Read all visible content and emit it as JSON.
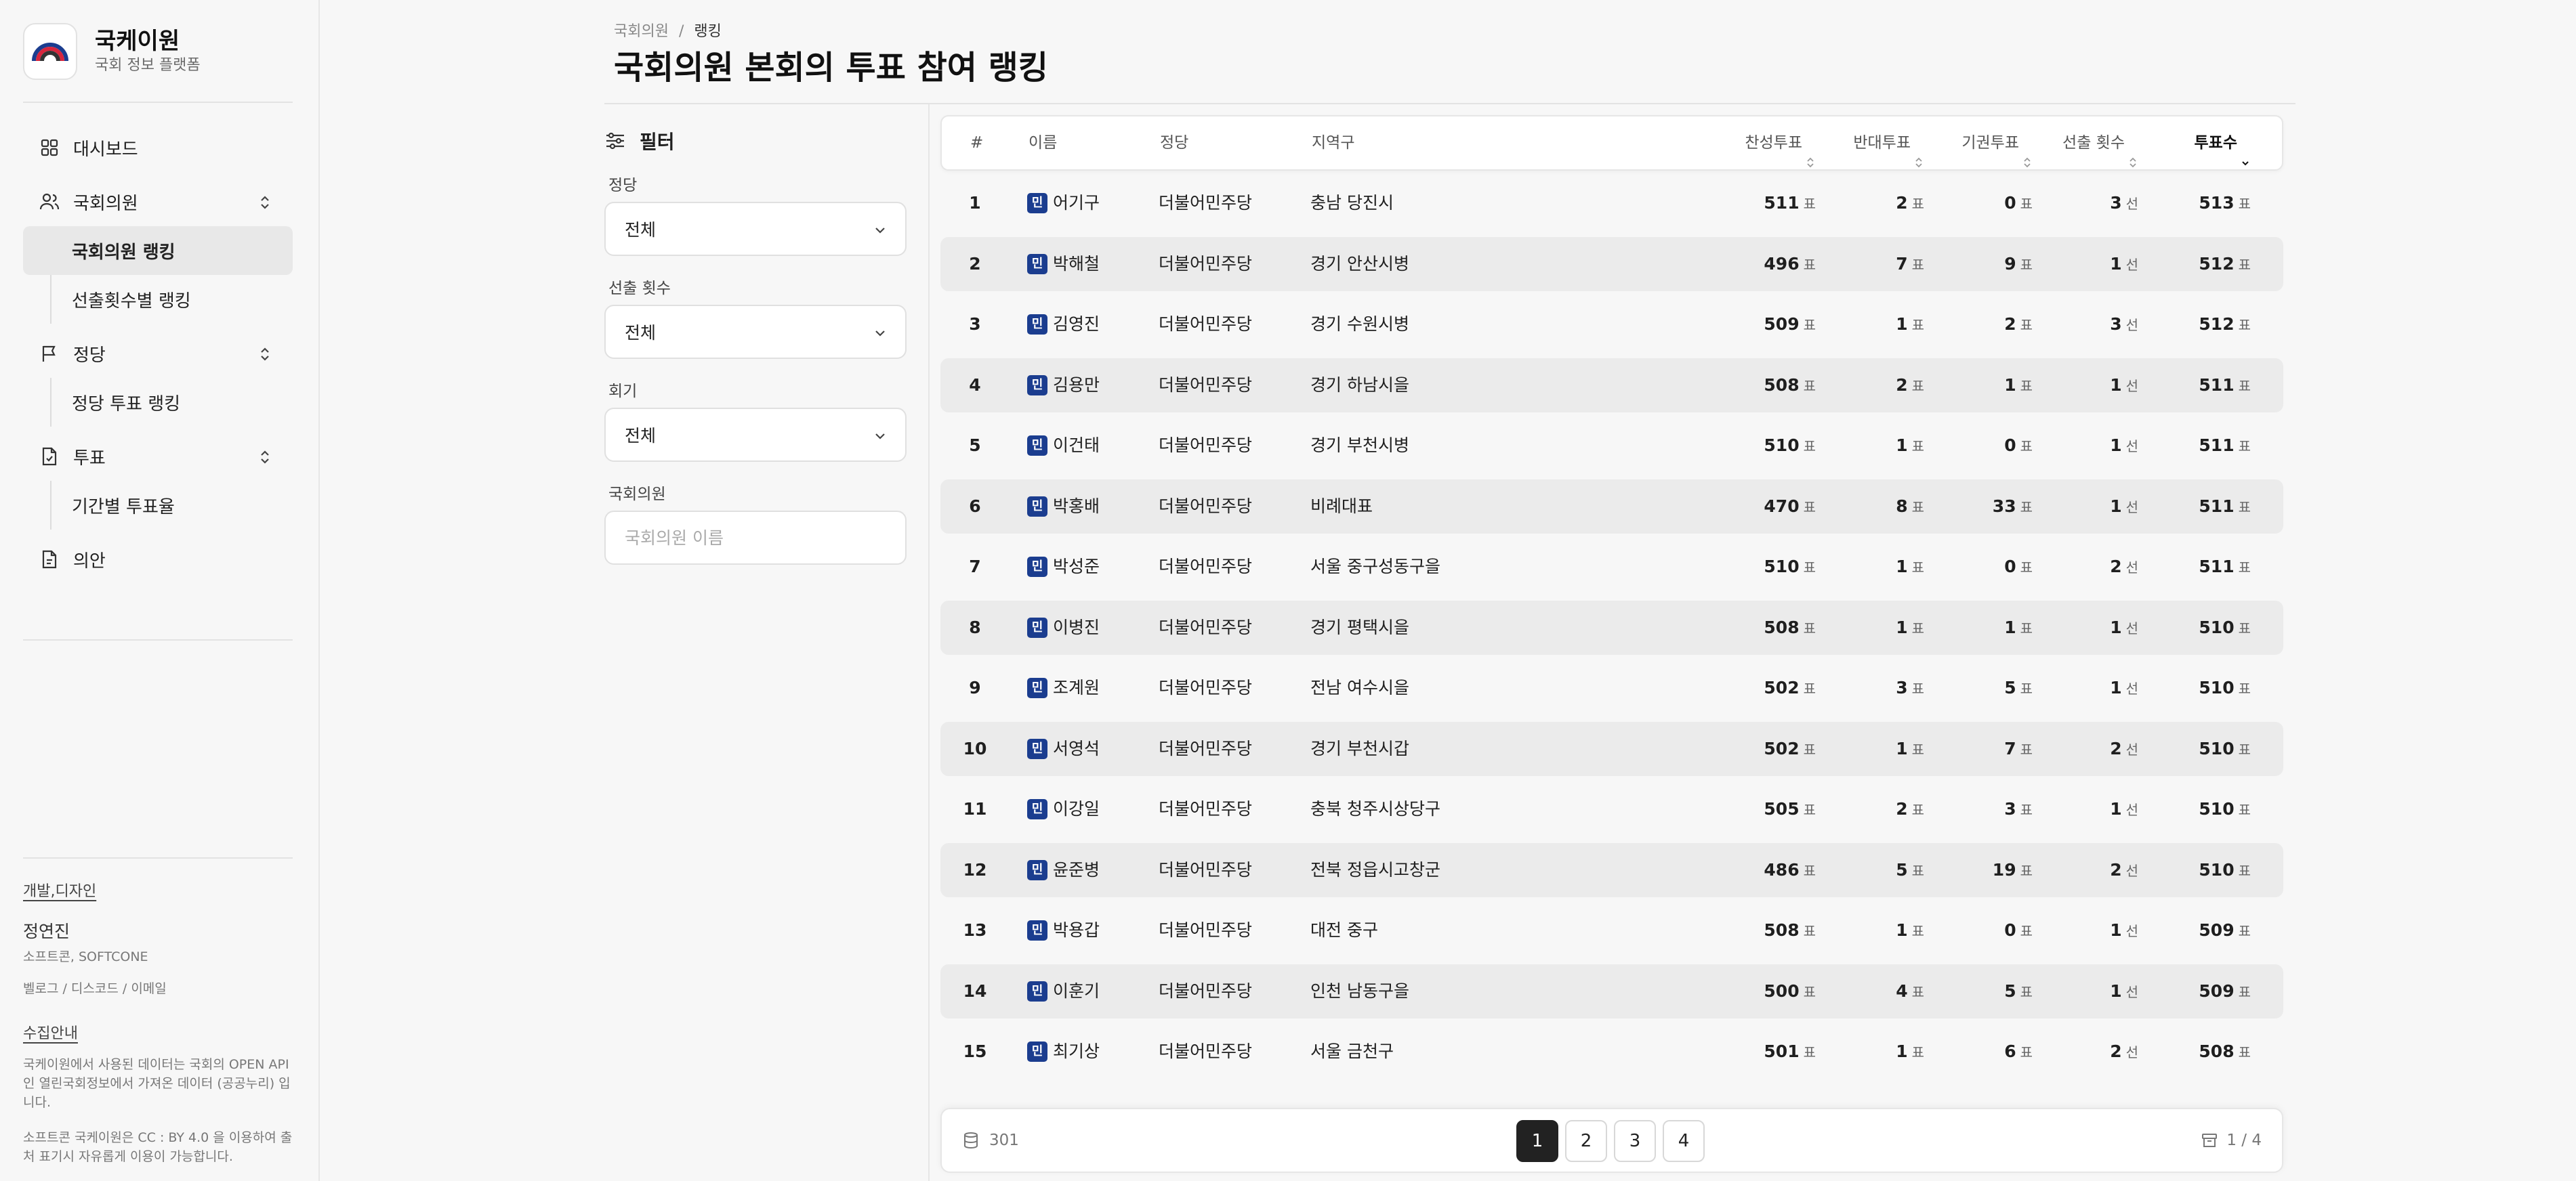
{
  "app": {
    "name": "국케이원",
    "subtitle": "국회 정보 플랫폼"
  },
  "nav": {
    "dashboard": "대시보드",
    "members": "국회의원",
    "members_sub": [
      "국회의원 랭킹",
      "선출횟수별 랭킹"
    ],
    "party": "정당",
    "party_sub": [
      "정당 투표 랭킹"
    ],
    "vote": "투표",
    "vote_sub": [
      "기간별 투표율"
    ],
    "bill": "의안"
  },
  "footer": {
    "dev_head": "개발,디자인",
    "dev_name": "정연진",
    "dev_org": "소프트콘, SOFTCONE",
    "dev_links": "벨로그 / 디스코드 / 이메일",
    "collect_head": "수집안내",
    "collect_text": "국케이원에서 사용된 데이터는 국회의 OPEN API인 열린국회정보에서 가져온 데이터 (공공누리) 입니다.",
    "license_text": "소프트콘 국케이원은 CC : BY 4.0 을 이용하여 출처 표기시 자유롭게 이용이 가능합니다."
  },
  "breadcrumb": {
    "parent": "국회의원",
    "sep": "/",
    "current": "랭킹"
  },
  "page_title": "국회의원 본회의 투표 참여 랭킹",
  "filter": {
    "title": "필터",
    "party_label": "정당",
    "party_value": "전체",
    "term_label": "선출 횟수",
    "term_value": "전체",
    "session_label": "회기",
    "session_value": "전체",
    "member_label": "국회의원",
    "member_placeholder": "국회의원 이름"
  },
  "table": {
    "headers": {
      "rank": "#",
      "name": "이름",
      "party": "정당",
      "region": "지역구",
      "yes": "찬성투표",
      "no": "반대투표",
      "abstain": "기권투표",
      "term": "선출 횟수",
      "total": "투표수"
    },
    "units": {
      "vote": "표",
      "term": "선"
    },
    "party_badge": "민",
    "rows": [
      {
        "rank": "1",
        "name": "어기구",
        "party": "더불어민주당",
        "region": "충남 당진시",
        "yes": "511",
        "no": "2",
        "abstain": "0",
        "term": "3",
        "total": "513"
      },
      {
        "rank": "2",
        "name": "박해철",
        "party": "더불어민주당",
        "region": "경기 안산시병",
        "yes": "496",
        "no": "7",
        "abstain": "9",
        "term": "1",
        "total": "512"
      },
      {
        "rank": "3",
        "name": "김영진",
        "party": "더불어민주당",
        "region": "경기 수원시병",
        "yes": "509",
        "no": "1",
        "abstain": "2",
        "term": "3",
        "total": "512"
      },
      {
        "rank": "4",
        "name": "김용만",
        "party": "더불어민주당",
        "region": "경기 하남시을",
        "yes": "508",
        "no": "2",
        "abstain": "1",
        "term": "1",
        "total": "511"
      },
      {
        "rank": "5",
        "name": "이건태",
        "party": "더불어민주당",
        "region": "경기 부천시병",
        "yes": "510",
        "no": "1",
        "abstain": "0",
        "term": "1",
        "total": "511"
      },
      {
        "rank": "6",
        "name": "박홍배",
        "party": "더불어민주당",
        "region": "비례대표",
        "yes": "470",
        "no": "8",
        "abstain": "33",
        "term": "1",
        "total": "511"
      },
      {
        "rank": "7",
        "name": "박성준",
        "party": "더불어민주당",
        "region": "서울 중구성동구을",
        "yes": "510",
        "no": "1",
        "abstain": "0",
        "term": "2",
        "total": "511"
      },
      {
        "rank": "8",
        "name": "이병진",
        "party": "더불어민주당",
        "region": "경기 평택시을",
        "yes": "508",
        "no": "1",
        "abstain": "1",
        "term": "1",
        "total": "510"
      },
      {
        "rank": "9",
        "name": "조계원",
        "party": "더불어민주당",
        "region": "전남 여수시을",
        "yes": "502",
        "no": "3",
        "abstain": "5",
        "term": "1",
        "total": "510"
      },
      {
        "rank": "10",
        "name": "서영석",
        "party": "더불어민주당",
        "region": "경기 부천시갑",
        "yes": "502",
        "no": "1",
        "abstain": "7",
        "term": "2",
        "total": "510"
      },
      {
        "rank": "11",
        "name": "이강일",
        "party": "더불어민주당",
        "region": "충북 청주시상당구",
        "yes": "505",
        "no": "2",
        "abstain": "3",
        "term": "1",
        "total": "510"
      },
      {
        "rank": "12",
        "name": "윤준병",
        "party": "더불어민주당",
        "region": "전북 정읍시고창군",
        "yes": "486",
        "no": "5",
        "abstain": "19",
        "term": "2",
        "total": "510"
      },
      {
        "rank": "13",
        "name": "박용갑",
        "party": "더불어민주당",
        "region": "대전 중구",
        "yes": "508",
        "no": "1",
        "abstain": "0",
        "term": "1",
        "total": "509"
      },
      {
        "rank": "14",
        "name": "이훈기",
        "party": "더불어민주당",
        "region": "인천 남동구을",
        "yes": "500",
        "no": "4",
        "abstain": "5",
        "term": "1",
        "total": "509"
      },
      {
        "rank": "15",
        "name": "최기상",
        "party": "더불어민주당",
        "region": "서울 금천구",
        "yes": "501",
        "no": "1",
        "abstain": "6",
        "term": "2",
        "total": "508"
      }
    ]
  },
  "pagination": {
    "total_count": "301",
    "pages": [
      "1",
      "2",
      "3",
      "4"
    ],
    "current": "1",
    "indicator": "1 / 4"
  },
  "colors": {
    "badge": "#1b3d8f",
    "active_page": "#222222",
    "row_alt": "#ebebeb"
  }
}
